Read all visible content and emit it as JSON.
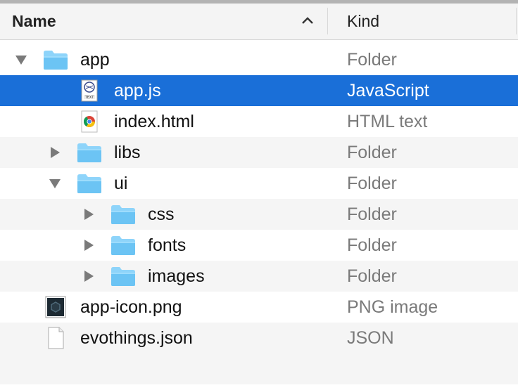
{
  "header": {
    "name_label": "Name",
    "kind_label": "Kind",
    "sort_icon": "chevron-up-icon"
  },
  "colors": {
    "selection": "#1a6fd8",
    "folder": "#6cc4f4",
    "kind_text": "#7a7a7a"
  },
  "rows": [
    {
      "name": "app",
      "kind": "Folder",
      "icon": "folder-icon",
      "disclosure": "expanded",
      "level": 0
    },
    {
      "name": "app.js",
      "kind": "JavaScript",
      "icon": "text-file-icon",
      "disclosure": "none",
      "level": 1,
      "selected": true
    },
    {
      "name": "index.html",
      "kind": "HTML text",
      "icon": "chrome-icon",
      "disclosure": "none",
      "level": 1
    },
    {
      "name": "libs",
      "kind": "Folder",
      "icon": "folder-icon",
      "disclosure": "collapsed",
      "level": 1
    },
    {
      "name": "ui",
      "kind": "Folder",
      "icon": "folder-icon",
      "disclosure": "expanded",
      "level": 1
    },
    {
      "name": "css",
      "kind": "Folder",
      "icon": "folder-icon",
      "disclosure": "collapsed",
      "level": 2
    },
    {
      "name": "fonts",
      "kind": "Folder",
      "icon": "folder-icon",
      "disclosure": "collapsed",
      "level": 2
    },
    {
      "name": "images",
      "kind": "Folder",
      "icon": "folder-icon",
      "disclosure": "collapsed",
      "level": 2
    },
    {
      "name": "app-icon.png",
      "kind": "PNG image",
      "icon": "png-image-icon",
      "disclosure": "none",
      "level": 0
    },
    {
      "name": "evothings.json",
      "kind": "JSON",
      "icon": "document-icon",
      "disclosure": "none",
      "level": 0
    }
  ]
}
